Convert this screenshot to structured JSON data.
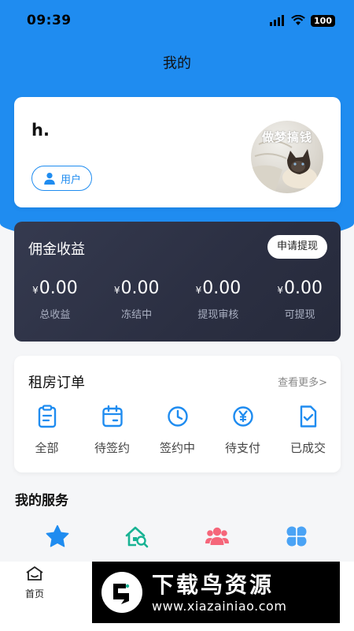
{
  "status_bar": {
    "time": "09:39",
    "battery": "100"
  },
  "header": {
    "title": "我的"
  },
  "profile": {
    "username": "h.",
    "role_label": "用户",
    "avatar_caption": "做梦搞钱"
  },
  "commission": {
    "title": "佣金收益",
    "withdraw_label": "申请提现",
    "currency": "¥",
    "stats": [
      {
        "value": "0.00",
        "label": "总收益"
      },
      {
        "value": "0.00",
        "label": "冻结中"
      },
      {
        "value": "0.00",
        "label": "提现审核"
      },
      {
        "value": "0.00",
        "label": "可提现"
      }
    ]
  },
  "orders": {
    "title": "租房订单",
    "more_label": "查看更多>",
    "items": [
      {
        "label": "全部",
        "icon": "clipboard-icon"
      },
      {
        "label": "待签约",
        "icon": "calendar-icon"
      },
      {
        "label": "签约中",
        "icon": "clock-icon"
      },
      {
        "label": "待支付",
        "icon": "yen-circle-icon"
      },
      {
        "label": "已成交",
        "icon": "document-check-icon"
      }
    ]
  },
  "services": {
    "title": "我的服务",
    "items": [
      {
        "icon": "star-icon",
        "color": "#1f8cf0"
      },
      {
        "icon": "house-search-icon",
        "color": "#19b394"
      },
      {
        "icon": "people-icon",
        "color": "#f5667a"
      },
      {
        "icon": "grid-flower-icon",
        "color": "#4aa3f5"
      }
    ]
  },
  "tabbar": {
    "home_label": "首页"
  },
  "watermark": {
    "title": "下载鸟资源",
    "url": "www.xiazainiao.com"
  },
  "colors": {
    "primary": "#1f8cf0",
    "card_dark": "#2b2f42"
  }
}
